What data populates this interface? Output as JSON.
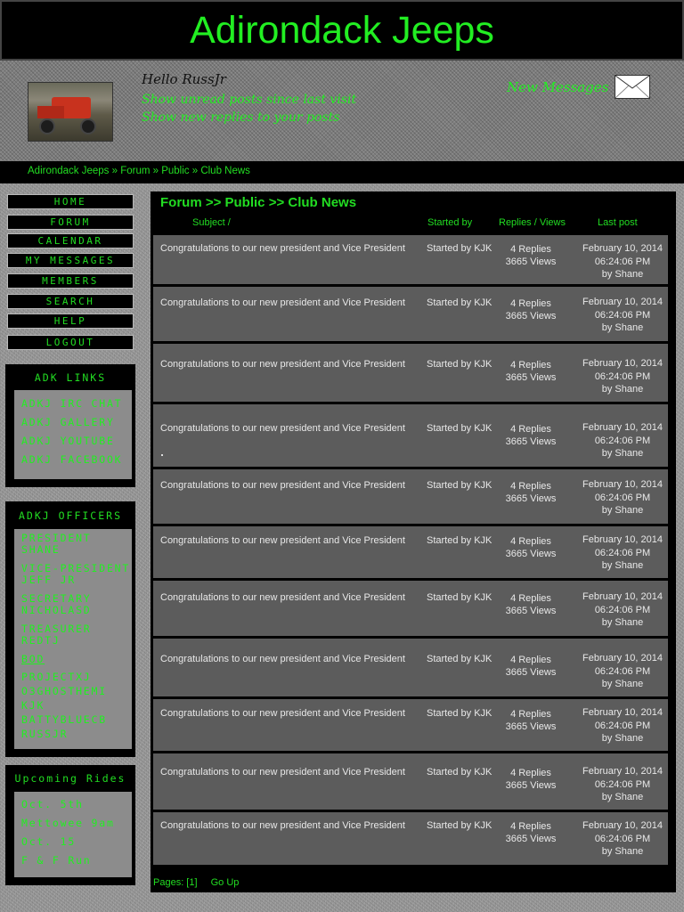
{
  "site": {
    "title": "Adirondack Jeeps"
  },
  "header": {
    "greeting": "Hello RussJr",
    "unread_link": "Show unread posts since last visit",
    "replies_link": "Show new replies to your posts",
    "new_messages": "New Messages"
  },
  "breadcrumb": "Adirondack Jeeps » Forum » Public » Club News",
  "nav": [
    {
      "label": "HOME"
    },
    {
      "label": "FORUM"
    },
    {
      "label": "CALENDAR"
    },
    {
      "label": "MY MESSAGES"
    },
    {
      "label": "MEMBERS"
    },
    {
      "label": "SEARCH"
    },
    {
      "label": "HELP"
    },
    {
      "label": "LOGOUT"
    }
  ],
  "adk_links": {
    "title": "ADK LINKS",
    "items": [
      "ADKJ IRC CHAT",
      "ADKJ GALLERY",
      "ADKJ YOUTUBE",
      "ADKJ FACEBOOK"
    ]
  },
  "officers": {
    "title": "ADKJ OFFICERS",
    "president": {
      "role": "PRESIDENT",
      "name": "SHANE"
    },
    "vice_president": {
      "role": "VICE-PRESIDENT",
      "name": "JEFF JR"
    },
    "secretary": {
      "role": "SECRETARY",
      "name": "NICHOLASD"
    },
    "treasurer": {
      "role": "TREASURER",
      "name": "REDTJ"
    },
    "bod_label": "BOD",
    "bod_members": [
      "PROJECTXJ",
      "O3GHOSTHEMI",
      "KJK",
      "BATTYBLUECB",
      "RUSSJR"
    ]
  },
  "rides": {
    "title": "Upcoming Rides",
    "items": [
      "Oct. 5th",
      "Mettowee 9am",
      "Oct. 15",
      "F & F Run"
    ]
  },
  "forum": {
    "title": "Forum >> Public >> Club News",
    "columns": {
      "subject": "Subject /",
      "started": "Started by",
      "stats": "Replies / Views",
      "last": "Last post"
    },
    "rows": [
      {
        "subject": "Congratulations to our new president and Vice President",
        "started": "Started by KJK",
        "replies": "4 Replies",
        "views": "3665 Views",
        "date": "February 10, 2014",
        "time": "06:24:06 PM",
        "by": "by Shane"
      },
      {
        "subject": "Congratulations to our new president and Vice President",
        "started": "Started by KJK",
        "replies": "4 Replies",
        "views": "3665 Views",
        "date": "February 10, 2014",
        "time": "06:24:06 PM",
        "by": "by Shane"
      },
      {
        "subject": "Congratulations to our new president and Vice President",
        "started": "Started by KJK",
        "replies": "4 Replies",
        "views": "3665 Views",
        "date": "February 10, 2014",
        "time": "06:24:06 PM",
        "by": "by Shane"
      },
      {
        "subject": "Congratulations to our new president and Vice President",
        "started": "Started by KJK",
        "replies": "4 Replies",
        "views": "3665 Views",
        "date": "February 10, 2014",
        "time": "06:24:06 PM",
        "by": "by Shane"
      },
      {
        "subject": "Congratulations to our new president and Vice President",
        "started": "Started by KJK",
        "replies": "4 Replies",
        "views": "3665 Views",
        "date": "February 10, 2014",
        "time": "06:24:06 PM",
        "by": "by Shane"
      },
      {
        "subject": "Congratulations to our new president and Vice President",
        "started": "Started by KJK",
        "replies": "4 Replies",
        "views": "3665 Views",
        "date": "February 10, 2014",
        "time": "06:24:06 PM",
        "by": "by Shane"
      },
      {
        "subject": "Congratulations to our new president and Vice President",
        "started": "Started by KJK",
        "replies": "4 Replies",
        "views": "3665 Views",
        "date": "February 10, 2014",
        "time": "06:24:06 PM",
        "by": "by Shane"
      },
      {
        "subject": "Congratulations to our new president and Vice President",
        "started": "Started by KJK",
        "replies": "4 Replies",
        "views": "3665 Views",
        "date": "February 10, 2014",
        "time": "06:24:06 PM",
        "by": "by Shane"
      },
      {
        "subject": "Congratulations to our new president and Vice President",
        "started": "Started by KJK",
        "replies": "4 Replies",
        "views": "3665 Views",
        "date": "February 10, 2014",
        "time": "06:24:06 PM",
        "by": "by Shane"
      },
      {
        "subject": "Congratulations to our new president and Vice President",
        "started": "Started by KJK",
        "replies": "4 Replies",
        "views": "3665 Views",
        "date": "February 10, 2014",
        "time": "06:24:06 PM",
        "by": "by Shane"
      },
      {
        "subject": "Congratulations to our new president and Vice President",
        "started": "Started by KJK",
        "replies": "4 Replies",
        "views": "3665 Views",
        "date": "February 10, 2014",
        "time": "06:24:06 PM",
        "by": "by Shane"
      }
    ],
    "pages_label": "Pages: [1]",
    "go_up": "Go Up"
  },
  "colors": {
    "accent": "#22dd22",
    "panel": "#000000",
    "row": "#5c5c5c"
  },
  "icons": {
    "messages": "envelope-icon"
  }
}
